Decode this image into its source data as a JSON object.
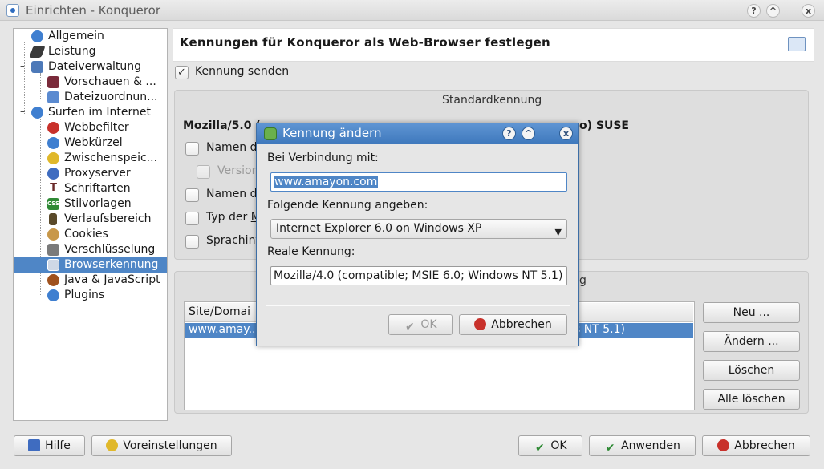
{
  "window": {
    "title": "Einrichten - Konqueror"
  },
  "titlebar_buttons": {
    "help": "?",
    "shade": "^",
    "close": "x"
  },
  "tree": {
    "items": [
      {
        "label": "Allgemein",
        "icon": "globe-icon",
        "color": "#3f7fd0"
      },
      {
        "label": "Leistung",
        "icon": "rocket-icon",
        "color": "#3a3a3a"
      },
      {
        "label": "Dateiverwaltung",
        "icon": "file-manager-icon",
        "color": "#4d79b8"
      },
      {
        "label": "Vorschauen & ...",
        "icon": "preview-icon",
        "color": "#7a2a3a"
      },
      {
        "label": "Dateizuordnun...",
        "icon": "file-association-icon",
        "color": "#5a8ad0"
      },
      {
        "label": "Surfen im Internet",
        "icon": "globe-icon",
        "color": "#3f7fd0"
      },
      {
        "label": "Webbefilter",
        "icon": "filter-icon",
        "color": "#c8312b"
      },
      {
        "label": "Webkürzel",
        "icon": "globe-icon",
        "color": "#3f7fd0"
      },
      {
        "label": "Zwischenspeic...",
        "icon": "cache-icon",
        "color": "#e0b82a"
      },
      {
        "label": "Proxyserver",
        "icon": "proxy-icon",
        "color": "#3f6cc0"
      },
      {
        "label": "Schriftarten",
        "icon": "font-icon",
        "color": "#6a2a2a"
      },
      {
        "label": "Stilvorlagen",
        "icon": "css-icon",
        "color": "#2f8a35"
      },
      {
        "label": "Verlaufsbereich",
        "icon": "hourglass-icon",
        "color": "#5a4a2a"
      },
      {
        "label": "Cookies",
        "icon": "cookie-icon",
        "color": "#c8984a"
      },
      {
        "label": "Verschlüsselung",
        "icon": "lock-icon",
        "color": "#7a7a7a"
      },
      {
        "label": "Browserkennung",
        "icon": "browser-id-icon",
        "color": "#cfd8e6"
      },
      {
        "label": "Java & JavaScript",
        "icon": "java-icon",
        "color": "#a0521e"
      },
      {
        "label": "Plugins",
        "icon": "plugin-icon",
        "color": "#3f7fd0"
      }
    ]
  },
  "page": {
    "header_title": "Kennungen für Konqueror als Web-Browser festlegen",
    "send_id_label": "Kennung senden",
    "send_id_checked": "✓",
    "group_title": "Standardkennung",
    "default_id_prefix": "Mozilla/5.0 (",
    "default_id_suffix": "o) SUSE",
    "opt_name_os": "Namen d",
    "opt_version": "Version",
    "opt_name_machine": "Namen d",
    "opt_type": "Typ der ",
    "opt_type_underlined": "M",
    "opt_lang": "Sprachinf",
    "specific_group_title_fragment": "g",
    "list_header_site": "Site/Domai",
    "list_row_site": "www.amay...",
    "list_row_id_fragment": "s NT 5.1)"
  },
  "side_buttons": {
    "new": "Neu ...",
    "change": "Ändern ...",
    "delete": "Löschen",
    "delete_all": "Alle löschen"
  },
  "bottom_buttons": {
    "help": "Hilfe",
    "defaults": "Voreinstellungen",
    "ok": "OK",
    "apply": "Anwenden",
    "cancel": "Abbrechen"
  },
  "dialog": {
    "title": "Kennung ändern",
    "connect_label": "Bei Verbindung mit:",
    "connect_value": "www.amayon.com",
    "use_id_label": "Folgende Kennung angeben:",
    "use_id_value": "Internet Explorer 6.0 on Windows XP",
    "real_id_label": "Reale Kennung:",
    "real_id_value": "Mozilla/4.0 (compatible; MSIE 6.0; Windows NT 5.1)",
    "ok": "OK",
    "cancel": "Abbrechen"
  }
}
